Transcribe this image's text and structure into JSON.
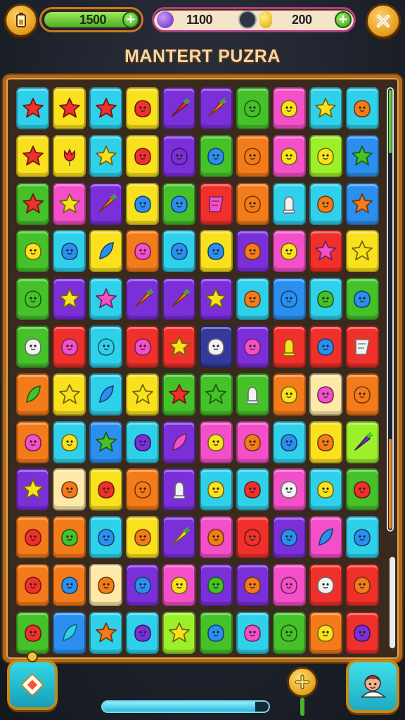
{
  "top_bar": {
    "energy_value": "1500",
    "gem_value": "1100",
    "coin_value": "200",
    "plus_label": "+"
  },
  "title": "MANTERT PUZRA",
  "colors": {
    "red": "#f0302a",
    "orange": "#f47b1a",
    "yellow": "#f9e11e",
    "green": "#45c12a",
    "cyan": "#2fd0ea",
    "blue": "#2b8ff0",
    "purple": "#7b2fd8",
    "pink": "#f34fc8",
    "lime": "#9cf02a",
    "cream": "#ffe9a8",
    "navy": "#333a9c",
    "white": "#f2f2f2"
  },
  "board": {
    "rows": [
      [
        [
          "cyan",
          "star",
          "red"
        ],
        [
          "yellow",
          "star",
          "red"
        ],
        [
          "cyan",
          "star",
          "red"
        ],
        [
          "yellow",
          "blob",
          "red"
        ],
        [
          "purple",
          "carrot",
          "red"
        ],
        [
          "purple",
          "carrot",
          "orange"
        ],
        [
          "green",
          "blob",
          "green"
        ],
        [
          "pink",
          "blob",
          "yellow"
        ],
        [
          "cyan",
          "star",
          "yellow"
        ],
        [
          "cyan",
          "blob",
          "orange"
        ]
      ],
      [
        [
          "yellow",
          "star",
          "red"
        ],
        [
          "yellow",
          "tulip",
          "red"
        ],
        [
          "cyan",
          "star",
          "yellow"
        ],
        [
          "yellow",
          "blob",
          "red"
        ],
        [
          "purple",
          "blob",
          "purple"
        ],
        [
          "green",
          "blob",
          "blue"
        ],
        [
          "orange",
          "blob",
          "orange"
        ],
        [
          "pink",
          "blob",
          "yellow"
        ],
        [
          "lime",
          "blob",
          "yellow"
        ],
        [
          "blue",
          "star",
          "green"
        ]
      ],
      [
        [
          "green",
          "star",
          "red"
        ],
        [
          "pink",
          "star",
          "yellow"
        ],
        [
          "purple",
          "carrot",
          "orange"
        ],
        [
          "yellow",
          "blob",
          "blue"
        ],
        [
          "green",
          "blob",
          "blue"
        ],
        [
          "red",
          "flag",
          "pink"
        ],
        [
          "orange",
          "blob",
          "orange"
        ],
        [
          "cyan",
          "bell",
          "white"
        ],
        [
          "cyan",
          "blob",
          "orange"
        ],
        [
          "blue",
          "star",
          "orange"
        ]
      ],
      [
        [
          "green",
          "blob",
          "yellow"
        ],
        [
          "cyan",
          "blob",
          "blue"
        ],
        [
          "yellow",
          "leaf",
          "blue"
        ],
        [
          "orange",
          "blob",
          "pink"
        ],
        [
          "cyan",
          "blob",
          "blue"
        ],
        [
          "yellow",
          "blob",
          "blue"
        ],
        [
          "purple",
          "blob",
          "orange"
        ],
        [
          "pink",
          "blob",
          "yellow"
        ],
        [
          "red",
          "star",
          "pink"
        ],
        [
          "yellow",
          "star",
          "yellow"
        ]
      ],
      [
        [
          "green",
          "blob",
          "green"
        ],
        [
          "purple",
          "star",
          "yellow"
        ],
        [
          "cyan",
          "star",
          "pink"
        ],
        [
          "purple",
          "carrot",
          "orange"
        ],
        [
          "purple",
          "carrot",
          "orange"
        ],
        [
          "purple",
          "star",
          "yellow"
        ],
        [
          "cyan",
          "blob",
          "orange"
        ],
        [
          "blue",
          "blob",
          "blue"
        ],
        [
          "cyan",
          "blob",
          "green"
        ],
        [
          "green",
          "blob",
          "blue"
        ]
      ],
      [
        [
          "green",
          "blob",
          "white"
        ],
        [
          "red",
          "blob",
          "pink"
        ],
        [
          "cyan",
          "blob",
          "cyan"
        ],
        [
          "red",
          "blob",
          "pink"
        ],
        [
          "red",
          "star",
          "yellow"
        ],
        [
          "navy",
          "blob",
          "white"
        ],
        [
          "purple",
          "blob",
          "pink"
        ],
        [
          "red",
          "bell",
          "yellow"
        ],
        [
          "red",
          "blob",
          "blue"
        ],
        [
          "red",
          "flag",
          "white"
        ]
      ],
      [
        [
          "orange",
          "leaf",
          "green"
        ],
        [
          "yellow",
          "star",
          "yellow"
        ],
        [
          "cyan",
          "leaf",
          "blue"
        ],
        [
          "yellow",
          "star",
          "yellow"
        ],
        [
          "green",
          "star",
          "red"
        ],
        [
          "green",
          "star",
          "green"
        ],
        [
          "green",
          "bell",
          "white"
        ],
        [
          "orange",
          "blob",
          "yellow"
        ],
        [
          "cream",
          "blob",
          "pink"
        ],
        [
          "orange",
          "blob",
          "orange"
        ]
      ],
      [
        [
          "orange",
          "blob",
          "pink"
        ],
        [
          "cyan",
          "blob",
          "yellow"
        ],
        [
          "blue",
          "star",
          "green"
        ],
        [
          "cyan",
          "blob",
          "purple"
        ],
        [
          "purple",
          "leaf",
          "pink"
        ],
        [
          "pink",
          "blob",
          "yellow"
        ],
        [
          "pink",
          "blob",
          "orange"
        ],
        [
          "cyan",
          "blob",
          "blue"
        ],
        [
          "yellow",
          "blob",
          "orange"
        ],
        [
          "lime",
          "carrot",
          "purple"
        ]
      ],
      [
        [
          "purple",
          "star",
          "yellow"
        ],
        [
          "cream",
          "blob",
          "orange"
        ],
        [
          "yellow",
          "blob",
          "red"
        ],
        [
          "orange",
          "blob",
          "orange"
        ],
        [
          "purple",
          "bell",
          "white"
        ],
        [
          "cyan",
          "blob",
          "yellow"
        ],
        [
          "cyan",
          "blob",
          "red"
        ],
        [
          "pink",
          "blob",
          "white"
        ],
        [
          "cyan",
          "blob",
          "yellow"
        ],
        [
          "green",
          "blob",
          "red"
        ]
      ],
      [
        [
          "orange",
          "blob",
          "red"
        ],
        [
          "orange",
          "blob",
          "green"
        ],
        [
          "cyan",
          "blob",
          "blue"
        ],
        [
          "yellow",
          "blob",
          "orange"
        ],
        [
          "purple",
          "carrot",
          "yellow"
        ],
        [
          "pink",
          "blob",
          "orange"
        ],
        [
          "red",
          "blob",
          "red"
        ],
        [
          "purple",
          "blob",
          "blue"
        ],
        [
          "pink",
          "leaf",
          "blue"
        ],
        [
          "cyan",
          "blob",
          "blue"
        ]
      ],
      [
        [
          "orange",
          "blob",
          "red"
        ],
        [
          "orange",
          "blob",
          "blue"
        ],
        [
          "cream",
          "blob",
          "orange"
        ],
        [
          "purple",
          "blob",
          "blue"
        ],
        [
          "pink",
          "blob",
          "yellow"
        ],
        [
          "purple",
          "blob",
          "green"
        ],
        [
          "purple",
          "blob",
          "orange"
        ],
        [
          "pink",
          "blob",
          "pink"
        ],
        [
          "red",
          "blob",
          "white"
        ],
        [
          "red",
          "blob",
          "orange"
        ]
      ],
      [
        [
          "green",
          "blob",
          "red"
        ],
        [
          "blue",
          "leaf",
          "cyan"
        ],
        [
          "cyan",
          "star",
          "orange"
        ],
        [
          "cyan",
          "blob",
          "purple"
        ],
        [
          "lime",
          "star",
          "yellow"
        ],
        [
          "green",
          "blob",
          "blue"
        ],
        [
          "cyan",
          "blob",
          "pink"
        ],
        [
          "green",
          "blob",
          "green"
        ],
        [
          "orange",
          "blob",
          "yellow"
        ],
        [
          "red",
          "blob",
          "purple"
        ]
      ]
    ]
  },
  "scrollbars": {
    "upper_thumb_top": "green",
    "upper_thumb_bottom": "orange"
  },
  "bottom": {
    "level_progress": 0.92
  },
  "icons": {
    "energy": "battery-icon",
    "close": "close-icon",
    "gem": "purple-gem-icon",
    "coin": "gold-coin-icon",
    "left_button": "diamond-card-icon",
    "hint": "plus-icon",
    "right_button": "character-portrait-icon"
  }
}
